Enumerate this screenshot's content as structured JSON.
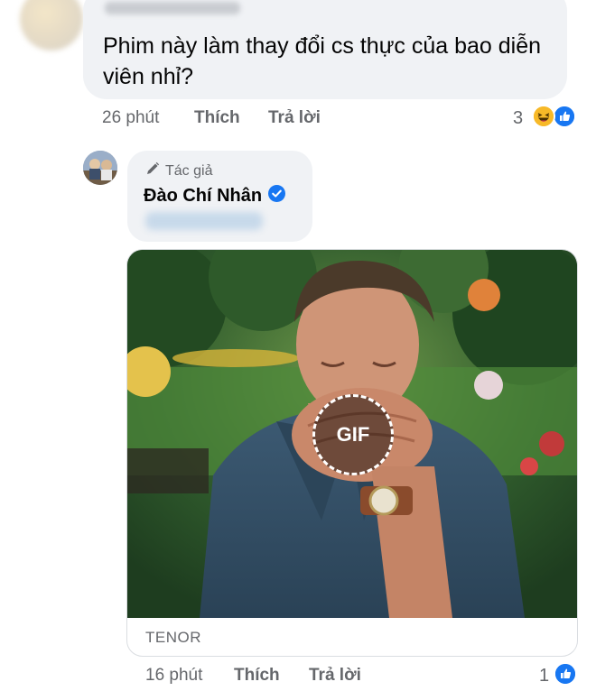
{
  "top_comment": {
    "text": "Phim này làm thay đổi cs thực của bao diễn viên nhỉ?",
    "time": "26 phút",
    "like_label": "Thích",
    "reply_label": "Trả lời",
    "reaction_count": "3",
    "reactions": [
      "haha-icon",
      "like-icon"
    ]
  },
  "reply": {
    "author_badge": "Tác giả",
    "author_name": "Đào Chí Nhân",
    "verified_icon": "verified-check-icon",
    "gif": {
      "badge": "GIF",
      "source": "TENOR"
    },
    "time": "16 phút",
    "like_label": "Thích",
    "reply_label": "Trả lời",
    "reaction_count": "1",
    "reactions": [
      "like-icon"
    ]
  },
  "colors": {
    "bubble_bg": "#f0f2f5",
    "meta_text": "#65676b",
    "like_blue": "#1877f2",
    "haha_yellow": "#f7b928"
  }
}
